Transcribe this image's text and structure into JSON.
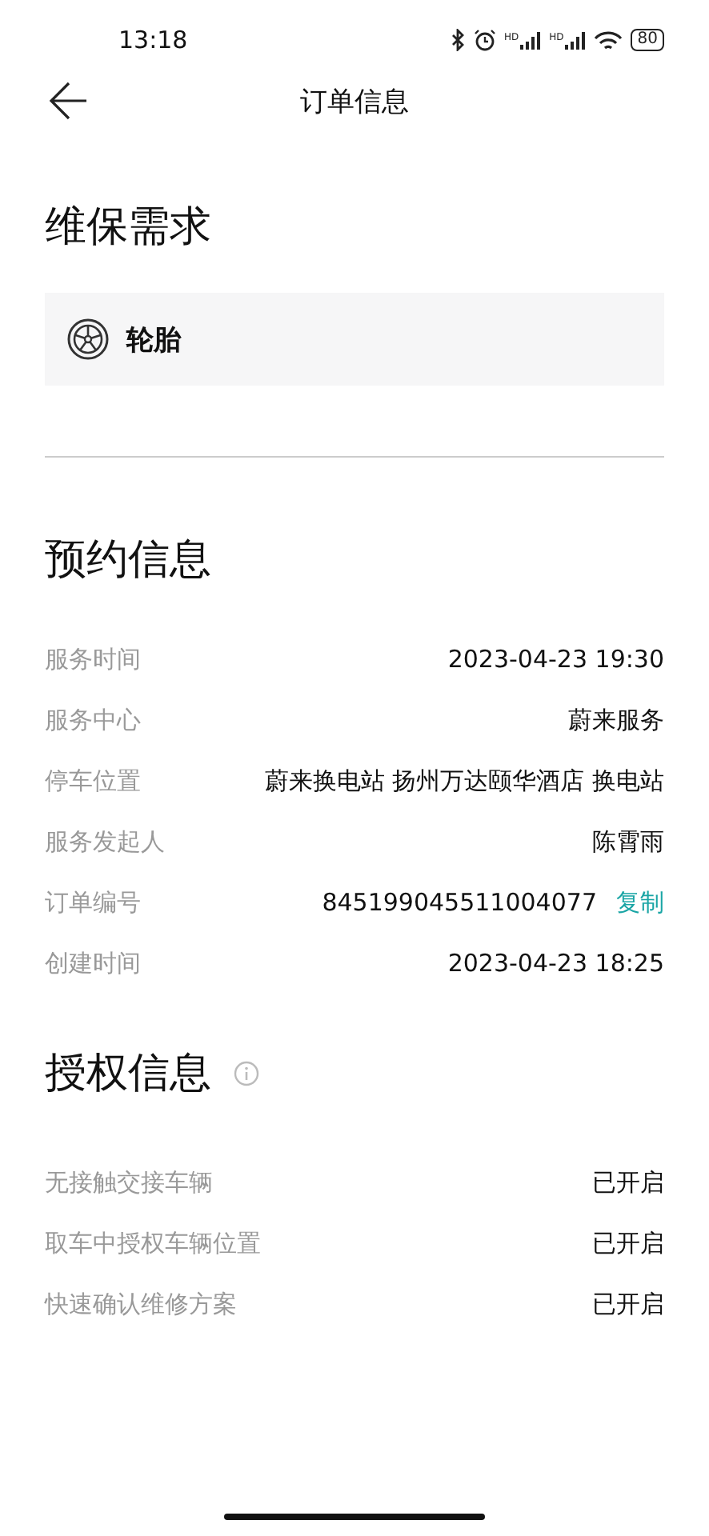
{
  "status_bar": {
    "time": "13:18",
    "signals": [
      {
        "label": "HD"
      },
      {
        "label": "HD"
      }
    ],
    "battery": "80"
  },
  "header": {
    "title": "订单信息"
  },
  "maintenance": {
    "title": "维保需求",
    "items": [
      {
        "label": "轮胎"
      }
    ]
  },
  "appointment": {
    "title": "预约信息",
    "rows": [
      {
        "label": "服务时间",
        "value": "2023-04-23 19:30"
      },
      {
        "label": "服务中心",
        "value": "蔚来服务"
      },
      {
        "label": "停车位置",
        "value": "蔚来换电站 扬州万达颐华酒店 换电站"
      },
      {
        "label": "服务发起人",
        "value": "陈霄雨"
      },
      {
        "label": "订单编号",
        "value": "845199045511004077",
        "action": "复制"
      },
      {
        "label": "创建时间",
        "value": "2023-04-23 18:25"
      }
    ]
  },
  "authorization": {
    "title": "授权信息",
    "rows": [
      {
        "label": "无接触交接车辆",
        "value": "已开启"
      },
      {
        "label": "取车中授权车辆位置",
        "value": "已开启"
      },
      {
        "label": "快速确认维修方案",
        "value": "已开启"
      }
    ]
  }
}
